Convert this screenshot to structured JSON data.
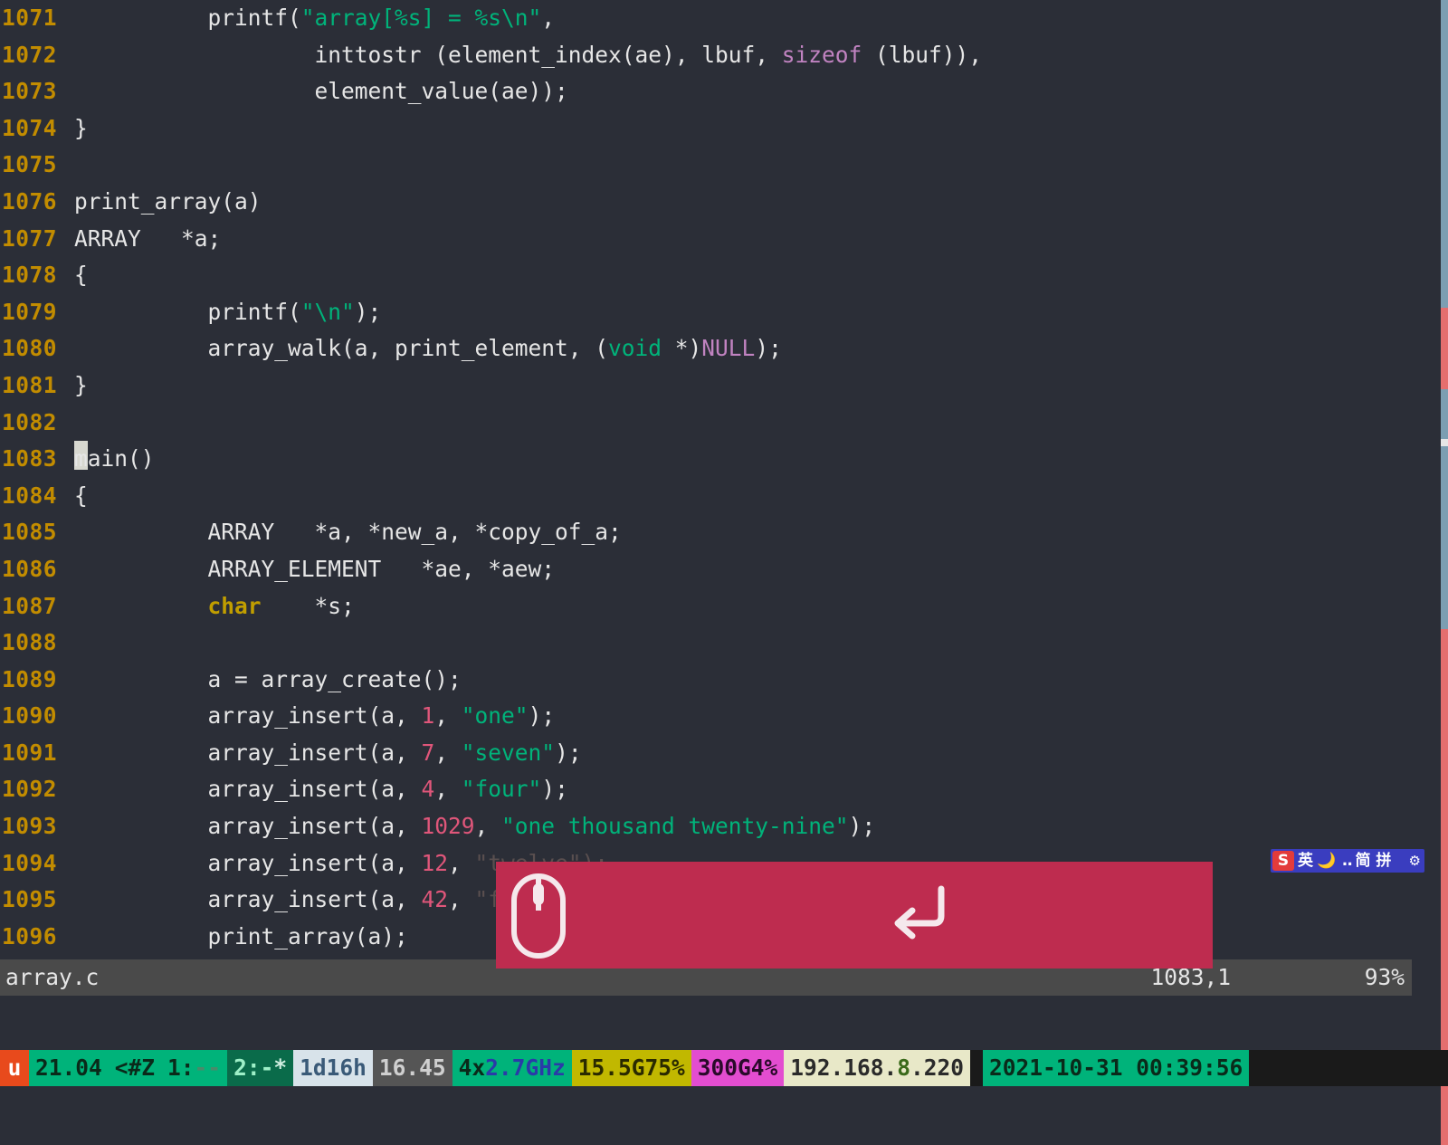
{
  "editor": {
    "first_line_no": 1071,
    "lines": [
      {
        "n": 1071,
        "tokens": [
          {
            "t": "          printf(",
            "c": ""
          },
          {
            "t": "\"array[%s] = %s\\n\"",
            "c": "tok-str"
          },
          {
            "t": ",",
            "c": ""
          }
        ]
      },
      {
        "n": 1072,
        "tokens": [
          {
            "t": "                  inttostr (element_index(ae), lbuf, ",
            "c": ""
          },
          {
            "t": "sizeof",
            "c": "tok-sz"
          },
          {
            "t": " (lbuf)),",
            "c": ""
          }
        ]
      },
      {
        "n": 1073,
        "tokens": [
          {
            "t": "                  element_value(ae));",
            "c": ""
          }
        ]
      },
      {
        "n": 1074,
        "tokens": [
          {
            "t": "}",
            "c": ""
          }
        ]
      },
      {
        "n": 1075,
        "tokens": [
          {
            "t": "",
            "c": ""
          }
        ]
      },
      {
        "n": 1076,
        "tokens": [
          {
            "t": "print_array(a)",
            "c": ""
          }
        ]
      },
      {
        "n": 1077,
        "tokens": [
          {
            "t": "ARRAY   *a;",
            "c": ""
          }
        ]
      },
      {
        "n": 1078,
        "tokens": [
          {
            "t": "{",
            "c": ""
          }
        ]
      },
      {
        "n": 1079,
        "tokens": [
          {
            "t": "          printf(",
            "c": ""
          },
          {
            "t": "\"\\n\"",
            "c": "tok-str"
          },
          {
            "t": ");",
            "c": ""
          }
        ]
      },
      {
        "n": 1080,
        "tokens": [
          {
            "t": "          array_walk(a, print_element, (",
            "c": ""
          },
          {
            "t": "void",
            "c": "tok-void"
          },
          {
            "t": " *)",
            "c": ""
          },
          {
            "t": "NULL",
            "c": "tok-const"
          },
          {
            "t": ");",
            "c": ""
          }
        ]
      },
      {
        "n": 1081,
        "tokens": [
          {
            "t": "}",
            "c": ""
          }
        ]
      },
      {
        "n": 1082,
        "tokens": [
          {
            "t": "",
            "c": ""
          }
        ]
      },
      {
        "n": 1083,
        "cursor": true,
        "tokens": [
          {
            "t": "main()",
            "c": ""
          }
        ]
      },
      {
        "n": 1084,
        "tokens": [
          {
            "t": "{",
            "c": ""
          }
        ]
      },
      {
        "n": 1085,
        "tokens": [
          {
            "t": "          ARRAY   *a, *new_a, *copy_of_a;",
            "c": ""
          }
        ]
      },
      {
        "n": 1086,
        "tokens": [
          {
            "t": "          ARRAY_ELEMENT   *ae, *aew;",
            "c": ""
          }
        ]
      },
      {
        "n": 1087,
        "tokens": [
          {
            "t": "          ",
            "c": ""
          },
          {
            "t": "char",
            "c": "tok-kw"
          },
          {
            "t": "    *s;",
            "c": ""
          }
        ]
      },
      {
        "n": 1088,
        "tokens": [
          {
            "t": "",
            "c": ""
          }
        ]
      },
      {
        "n": 1089,
        "tokens": [
          {
            "t": "          a = array_create();",
            "c": ""
          }
        ]
      },
      {
        "n": 1090,
        "tokens": [
          {
            "t": "          array_insert(a, ",
            "c": ""
          },
          {
            "t": "1",
            "c": "tok-num"
          },
          {
            "t": ", ",
            "c": ""
          },
          {
            "t": "\"one\"",
            "c": "tok-str"
          },
          {
            "t": ");",
            "c": ""
          }
        ]
      },
      {
        "n": 1091,
        "tokens": [
          {
            "t": "          array_insert(a, ",
            "c": ""
          },
          {
            "t": "7",
            "c": "tok-num"
          },
          {
            "t": ", ",
            "c": ""
          },
          {
            "t": "\"seven\"",
            "c": "tok-str"
          },
          {
            "t": ");",
            "c": ""
          }
        ]
      },
      {
        "n": 1092,
        "tokens": [
          {
            "t": "          array_insert(a, ",
            "c": ""
          },
          {
            "t": "4",
            "c": "tok-num"
          },
          {
            "t": ", ",
            "c": ""
          },
          {
            "t": "\"four\"",
            "c": "tok-str"
          },
          {
            "t": ");",
            "c": ""
          }
        ]
      },
      {
        "n": 1093,
        "tokens": [
          {
            "t": "          array_insert(a, ",
            "c": ""
          },
          {
            "t": "1029",
            "c": "tok-num"
          },
          {
            "t": ", ",
            "c": ""
          },
          {
            "t": "\"one thousand twenty-nine\"",
            "c": "tok-str"
          },
          {
            "t": ");",
            "c": ""
          }
        ]
      },
      {
        "n": 1094,
        "tokens": [
          {
            "t": "          array_insert(a, ",
            "c": ""
          },
          {
            "t": "12",
            "c": "tok-num"
          },
          {
            "t": ", ",
            "c": ""
          },
          {
            "t": "\"twelve\");",
            "c": "tok-dim"
          }
        ]
      },
      {
        "n": 1095,
        "tokens": [
          {
            "t": "          array_insert(a, ",
            "c": ""
          },
          {
            "t": "42",
            "c": "tok-num"
          },
          {
            "t": ", ",
            "c": ""
          },
          {
            "t": "\"forty-two\");",
            "c": "tok-dim"
          }
        ]
      },
      {
        "n": 1096,
        "tokens": [
          {
            "t": "          print_array(a);",
            "c": ""
          }
        ]
      }
    ]
  },
  "vim_status": {
    "filename": "array.c",
    "position": "1083,1",
    "percent": "93%"
  },
  "ime": {
    "s": "S",
    "lang": "英",
    "mode": "简 拼"
  },
  "tmux": {
    "prefix": "u",
    "version": "21.04",
    "hz_marker": "<#Z",
    "win1_index": "1:",
    "win1_dash": "--",
    "win2_index": "2:",
    "win2_dash": "-",
    "win2_star": "*",
    "uptime": "1d16h",
    "loadavg": "16.45",
    "cpu_cores": "4",
    "cpu_x": "x",
    "cpu_freq": "2.7",
    "cpu_unit": "GHz",
    "mem": "15.5G75%",
    "gpu": "300G4%",
    "ip_a": "192.168.",
    "ip_b": "8",
    "ip_c": ".220",
    "timestamp": "2021-10-31 00:39:56"
  }
}
